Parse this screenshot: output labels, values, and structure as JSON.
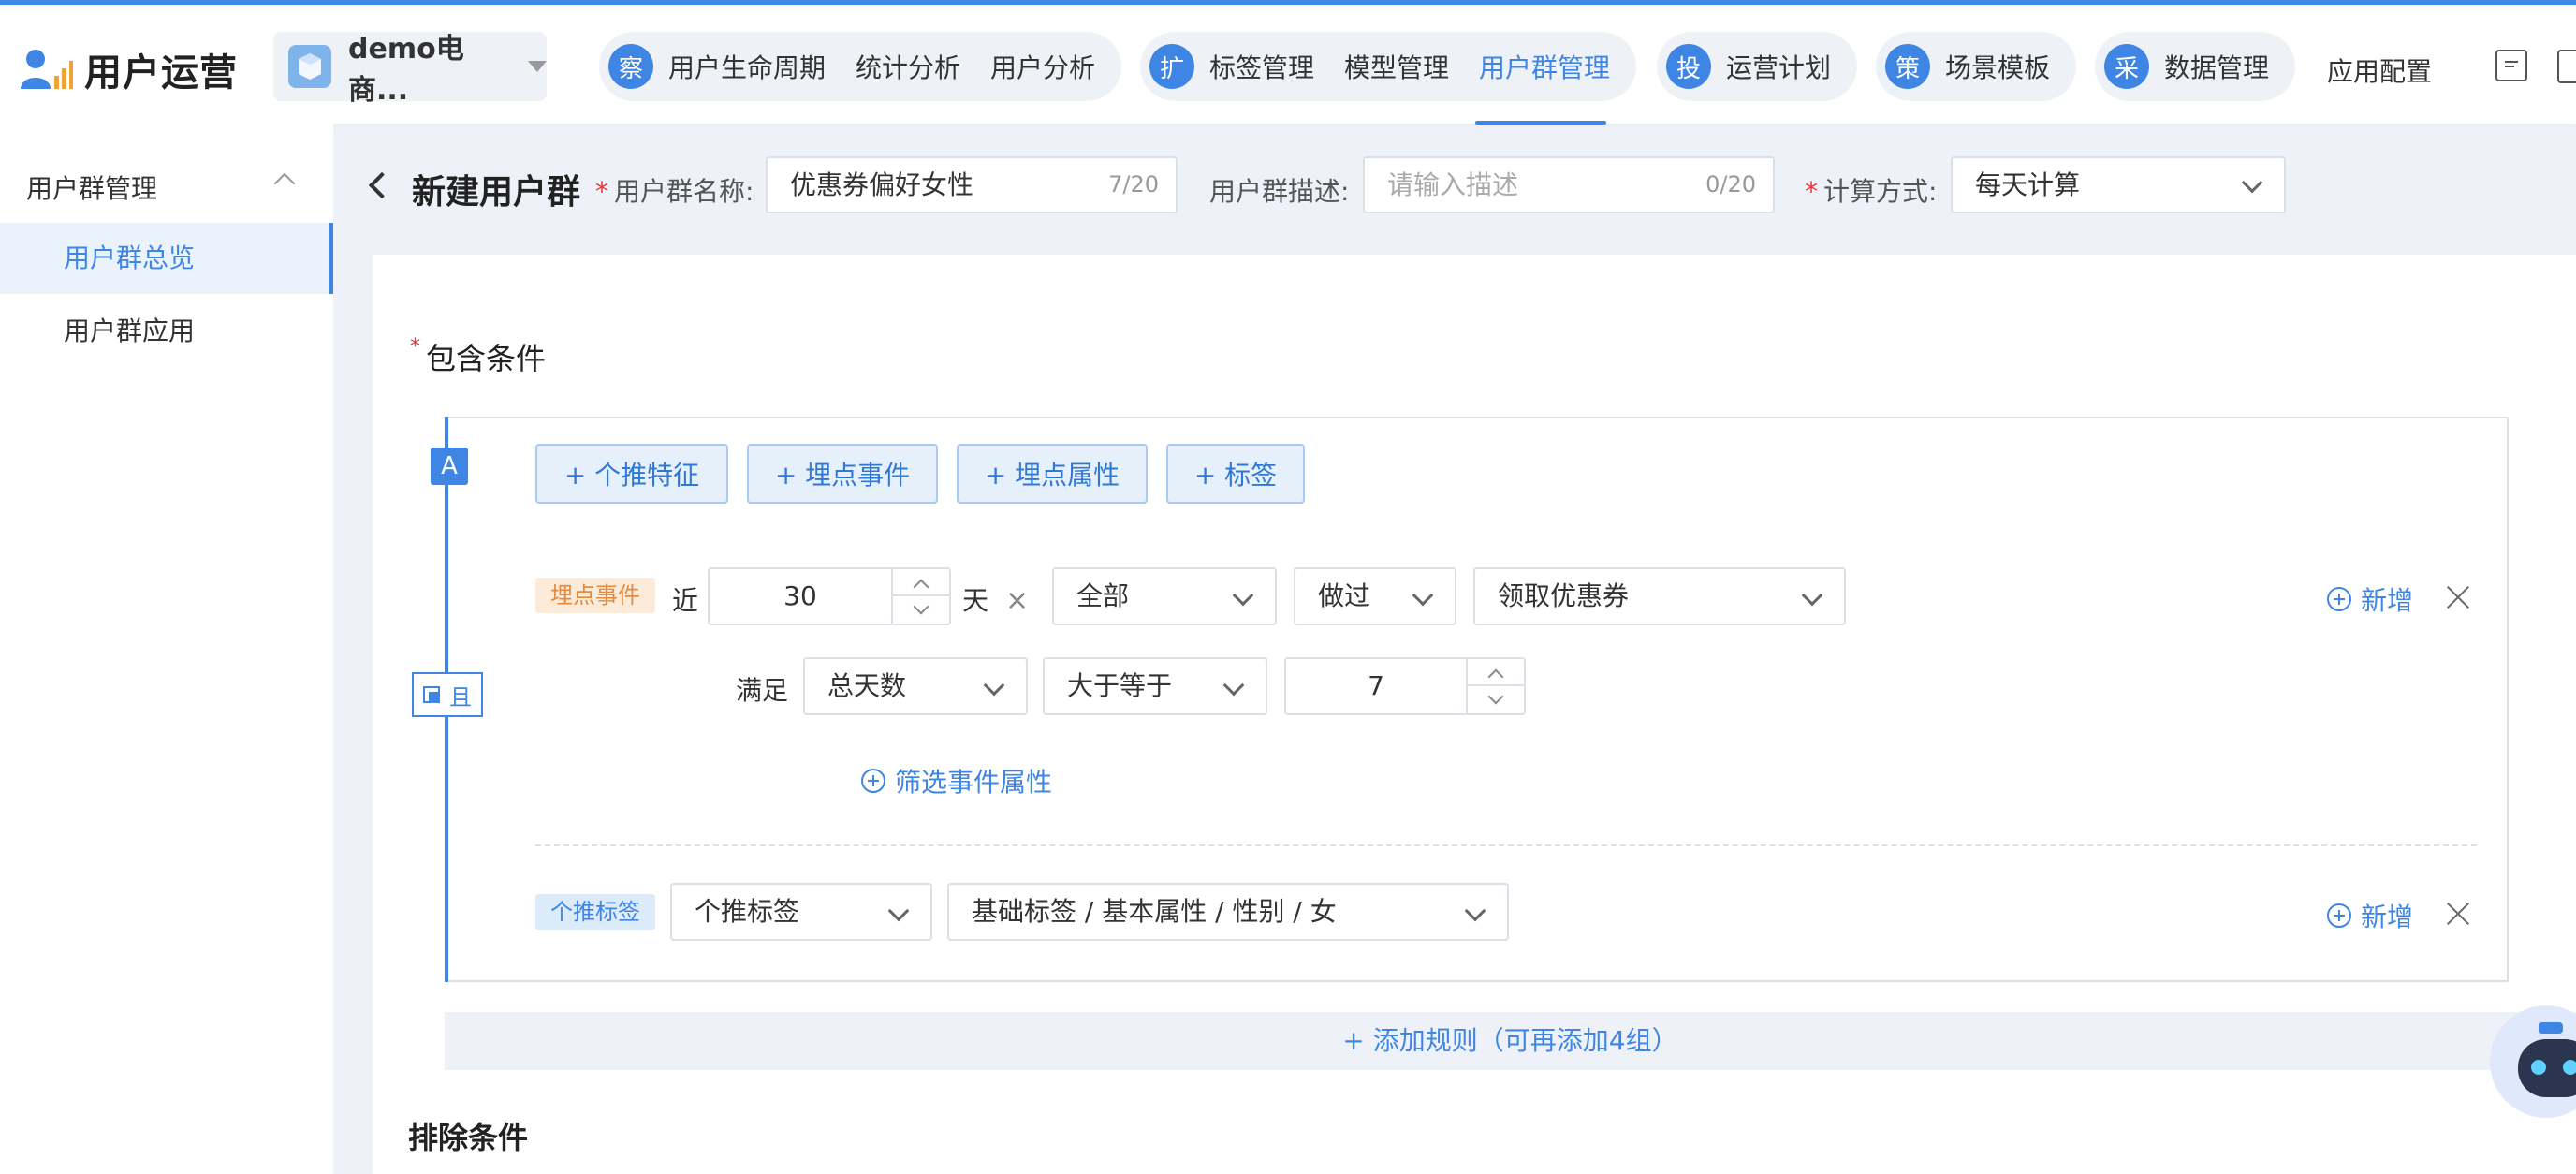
{
  "header": {
    "app_title": "用户运营",
    "app_selector": "demo电商...",
    "nav_groups": [
      {
        "badge": "察",
        "items": [
          "用户生命周期",
          "统计分析",
          "用户分析"
        ]
      },
      {
        "badge": "扩",
        "items": [
          "标签管理",
          "模型管理",
          "用户群管理"
        ]
      },
      {
        "badge": "投",
        "items": [
          "运营计划"
        ]
      },
      {
        "badge": "策",
        "items": [
          "场景模板"
        ]
      },
      {
        "badge": "采",
        "items": [
          "数据管理"
        ]
      }
    ],
    "nav_plain": "应用配置",
    "active_nav": "用户群管理",
    "accent_color": "#3f86e4"
  },
  "sidebar": {
    "group_label": "用户群管理",
    "items": [
      "用户群总览",
      "用户群应用"
    ],
    "active_item": "用户群总览"
  },
  "form": {
    "page_title": "新建用户群",
    "name_label": "用户群名称:",
    "name_value": "优惠券偏好女性",
    "name_count": "7/20",
    "desc_label": "用户群描述:",
    "desc_placeholder": "请输入描述",
    "desc_count": "0/20",
    "calc_label": "计算方式:",
    "calc_value": "每天计算"
  },
  "include": {
    "title": "包含条件",
    "group_letter": "A",
    "and_label": "且",
    "add_buttons": [
      "+ 个推特征",
      "+ 埋点事件",
      "+ 埋点属性",
      "+ 标签"
    ],
    "rule1": {
      "tag": "埋点事件",
      "prefix": "近",
      "days": "30",
      "unit": "天",
      "scope": "全部",
      "action": "做过",
      "event": "领取优惠券",
      "satisfy_label": "满足",
      "metric": "总天数",
      "operator": "大于等于",
      "threshold": "7",
      "filter_link": "筛选事件属性",
      "add_link": "新增"
    },
    "rule2": {
      "tag": "个推标签",
      "type": "个推标签",
      "value": "基础标签 / 基本属性 / 性别 / 女",
      "add_link": "新增"
    },
    "add_rule": "+ 添加规则（可再添加4组）"
  },
  "exclude": {
    "title": "排除条件"
  }
}
